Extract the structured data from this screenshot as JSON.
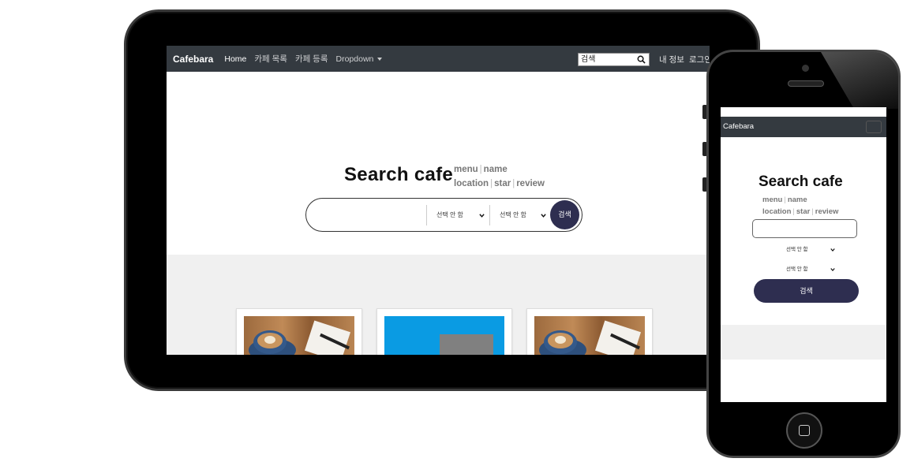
{
  "colors": {
    "navbar": "#343a40",
    "submit_button": "#2e2e50",
    "band": "#f0f0f0"
  },
  "tablet": {
    "nav": {
      "brand": "Cafebara",
      "links": [
        "Home",
        "카페 목록",
        "카페 등록",
        "Dropdown"
      ],
      "search_value": "검색",
      "my_info": "내 정보",
      "login": "로그인"
    },
    "hero": {
      "title": "Search cafe",
      "hint_line1": [
        "menu",
        "name"
      ],
      "hint_line2": [
        "location",
        "star",
        "review"
      ]
    },
    "search": {
      "select1": "선택 안 함",
      "select2": "선택 안 함",
      "submit": "검색"
    },
    "cards": [
      {
        "image": "coffee-photo"
      },
      {
        "image": "placeholder-image"
      },
      {
        "image": "coffee-photo"
      }
    ]
  },
  "phone": {
    "nav": {
      "brand": "Cafebara"
    },
    "hero": {
      "title": "Search cafe",
      "hint_line1": [
        "menu",
        "name"
      ],
      "hint_line2": [
        "location",
        "star",
        "review"
      ]
    },
    "search": {
      "select1": "선택 안 함",
      "select2": "선택 안 함",
      "submit": "검색"
    }
  }
}
